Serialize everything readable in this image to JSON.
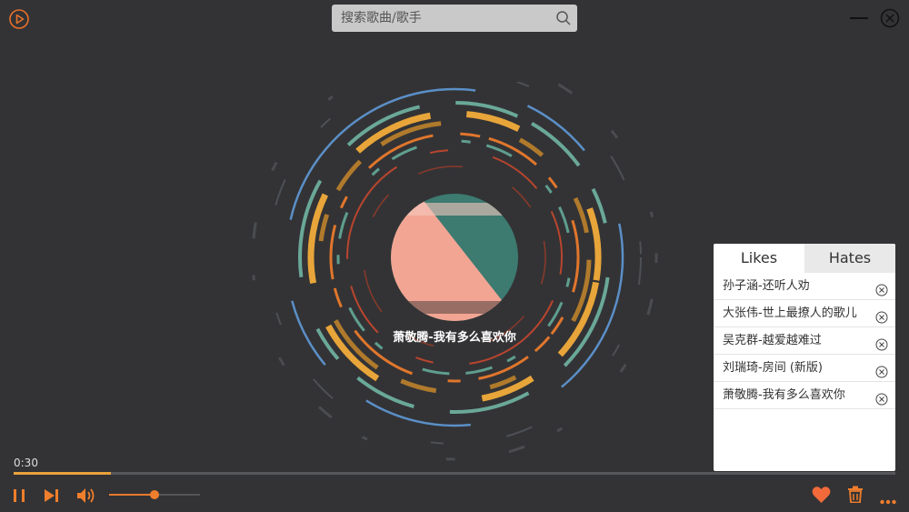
{
  "search": {
    "placeholder": "搜索歌曲/歌手"
  },
  "now_playing": {
    "title": "萧敬腾-我有多么喜欢你",
    "elapsed": "0:30",
    "progress": 0.11,
    "volume": 0.5
  },
  "panel": {
    "tabs": [
      {
        "label": "Likes",
        "active": true
      },
      {
        "label": "Hates",
        "active": false
      }
    ],
    "items": [
      {
        "label": "孙子涵-还听人劝"
      },
      {
        "label": "大张伟-世上最撩人的歌儿"
      },
      {
        "label": "吴克群-越爱越难过"
      },
      {
        "label": "刘瑞琦-房间 (新版)"
      },
      {
        "label": "萧敬腾-我有多么喜欢你"
      }
    ]
  },
  "icons": {
    "logo": "play-circle-icon",
    "search": "search-icon",
    "minimize": "minimize-icon",
    "close": "close-circle-icon",
    "pause": "pause-icon",
    "next": "skip-next-icon",
    "volume": "volume-icon",
    "heart": "heart-icon",
    "trash": "trash-icon",
    "more": "more-icon"
  },
  "colors": {
    "accent": "#f07e2c",
    "progress": "#e8a23a",
    "background": "#333335"
  }
}
